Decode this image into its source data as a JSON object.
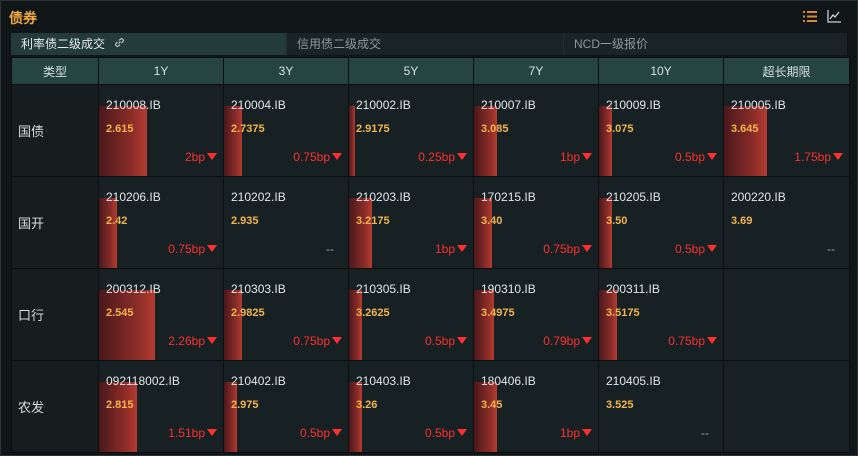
{
  "header": {
    "title": "债券"
  },
  "icons": {
    "list": "list-icon",
    "chart": "line-chart-icon"
  },
  "tabs": [
    {
      "label": "利率债二级成交",
      "active": true
    },
    {
      "label": "信用债二级成交",
      "active": false
    },
    {
      "label": "NCD一级报价",
      "active": false
    }
  ],
  "table": {
    "columns": [
      "类型",
      "1Y",
      "3Y",
      "5Y",
      "7Y",
      "10Y",
      "超长期限"
    ],
    "rows": [
      {
        "type": "国债",
        "cells": [
          {
            "code": "210008.IB",
            "price": "2.615",
            "change": "2bp",
            "down": true,
            "level": 0.38
          },
          {
            "code": "210004.IB",
            "price": "2.7375",
            "change": "0.75bp",
            "down": true,
            "level": 0.14
          },
          {
            "code": "210002.IB",
            "price": "2.9175",
            "change": "0.25bp",
            "down": true,
            "level": 0.05
          },
          {
            "code": "210007.IB",
            "price": "3.085",
            "change": "1bp",
            "down": true,
            "level": 0.18
          },
          {
            "code": "210009.IB",
            "price": "3.075",
            "change": "0.5bp",
            "down": true,
            "level": 0.1
          },
          {
            "code": "210005.IB",
            "price": "3.645",
            "change": "1.75bp",
            "down": true,
            "level": 0.34
          }
        ]
      },
      {
        "type": "国开",
        "cells": [
          {
            "code": "210206.IB",
            "price": "2.42",
            "change": "0.75bp",
            "down": true,
            "level": 0.14
          },
          {
            "code": "210202.IB",
            "price": "2.935",
            "change": "--",
            "down": false,
            "level": 0
          },
          {
            "code": "210203.IB",
            "price": "3.2175",
            "change": "1bp",
            "down": true,
            "level": 0.18
          },
          {
            "code": "170215.IB",
            "price": "3.40",
            "change": "0.75bp",
            "down": true,
            "level": 0.14
          },
          {
            "code": "210205.IB",
            "price": "3.50",
            "change": "0.5bp",
            "down": true,
            "level": 0.1
          },
          {
            "code": "200220.IB",
            "price": "3.69",
            "change": "--",
            "down": false,
            "level": 0
          }
        ]
      },
      {
        "type": "口行",
        "cells": [
          {
            "code": "200312.IB",
            "price": "2.545",
            "change": "2.26bp",
            "down": true,
            "level": 0.45
          },
          {
            "code": "210303.IB",
            "price": "2.9825",
            "change": "0.75bp",
            "down": true,
            "level": 0.14
          },
          {
            "code": "210305.IB",
            "price": "3.2625",
            "change": "0.5bp",
            "down": true,
            "level": 0.1
          },
          {
            "code": "190310.IB",
            "price": "3.4975",
            "change": "0.79bp",
            "down": true,
            "level": 0.16
          },
          {
            "code": "200311.IB",
            "price": "3.5175",
            "change": "0.75bp",
            "down": true,
            "level": 0.14
          },
          {
            "code": "",
            "price": "",
            "change": "",
            "down": false,
            "level": 0
          }
        ]
      },
      {
        "type": "农发",
        "cells": [
          {
            "code": "092118002.IB",
            "price": "2.815",
            "change": "1.51bp",
            "down": true,
            "level": 0.3
          },
          {
            "code": "210402.IB",
            "price": "2.975",
            "change": "0.5bp",
            "down": true,
            "level": 0.1
          },
          {
            "code": "210403.IB",
            "price": "3.26",
            "change": "0.5bp",
            "down": true,
            "level": 0.1
          },
          {
            "code": "180406.IB",
            "price": "3.45",
            "change": "1bp",
            "down": true,
            "level": 0.18
          },
          {
            "code": "210405.IB",
            "price": "3.525",
            "change": "--",
            "down": false,
            "level": 0
          },
          {
            "code": "",
            "price": "",
            "change": "",
            "down": false,
            "level": 0
          }
        ]
      }
    ]
  },
  "colors": {
    "accent": "#f0a844",
    "down": "#ff2f2f",
    "header_bg": "#264541"
  }
}
